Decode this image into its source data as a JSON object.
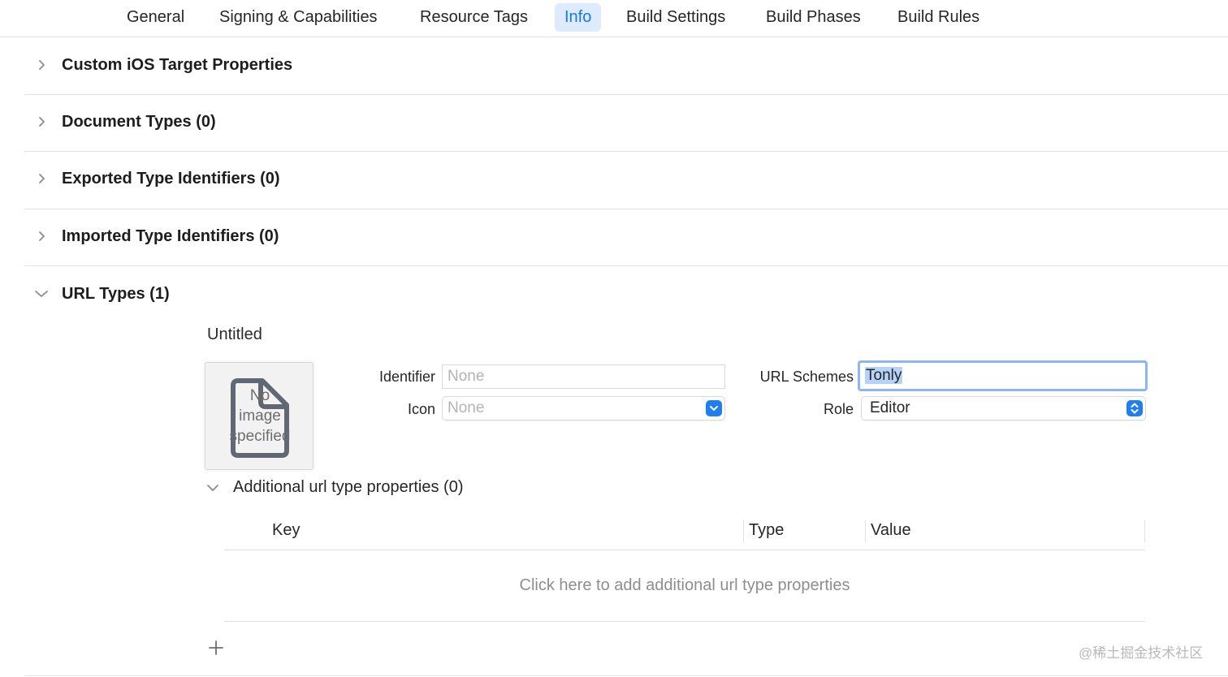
{
  "tabs": [
    {
      "label": "General"
    },
    {
      "label": "Signing & Capabilities"
    },
    {
      "label": "Resource Tags"
    },
    {
      "label": "Info",
      "active": true
    },
    {
      "label": "Build Settings"
    },
    {
      "label": "Build Phases"
    },
    {
      "label": "Build Rules"
    }
  ],
  "sections": [
    {
      "title": "Custom iOS Target Properties",
      "expanded": false
    },
    {
      "title": "Document Types (0)",
      "expanded": false
    },
    {
      "title": "Exported Type Identifiers (0)",
      "expanded": false
    },
    {
      "title": "Imported Type Identifiers (0)",
      "expanded": false
    },
    {
      "title": "URL Types (1)",
      "expanded": true
    }
  ],
  "url_type": {
    "name": "Untitled",
    "image_placeholder": "No\nimage\nspecified",
    "identifier_label": "Identifier",
    "identifier_placeholder": "None",
    "icon_label": "Icon",
    "icon_placeholder": "None",
    "url_schemes_label": "URL Schemes",
    "url_schemes_value": "Tonly",
    "role_label": "Role",
    "role_value": "Editor"
  },
  "additional": {
    "title": "Additional url type properties (0)",
    "columns": [
      "Key",
      "Type",
      "Value"
    ],
    "empty_message": "Click here to add additional url type properties",
    "add_button": "+"
  },
  "watermark": "@稀土掘金技术社区",
  "colors": {
    "accent": "#1b78e8",
    "tab_active_bg": "#dcebfd",
    "popup_button": "#1f7ff0",
    "focus_ring": "#8cb5f3"
  }
}
